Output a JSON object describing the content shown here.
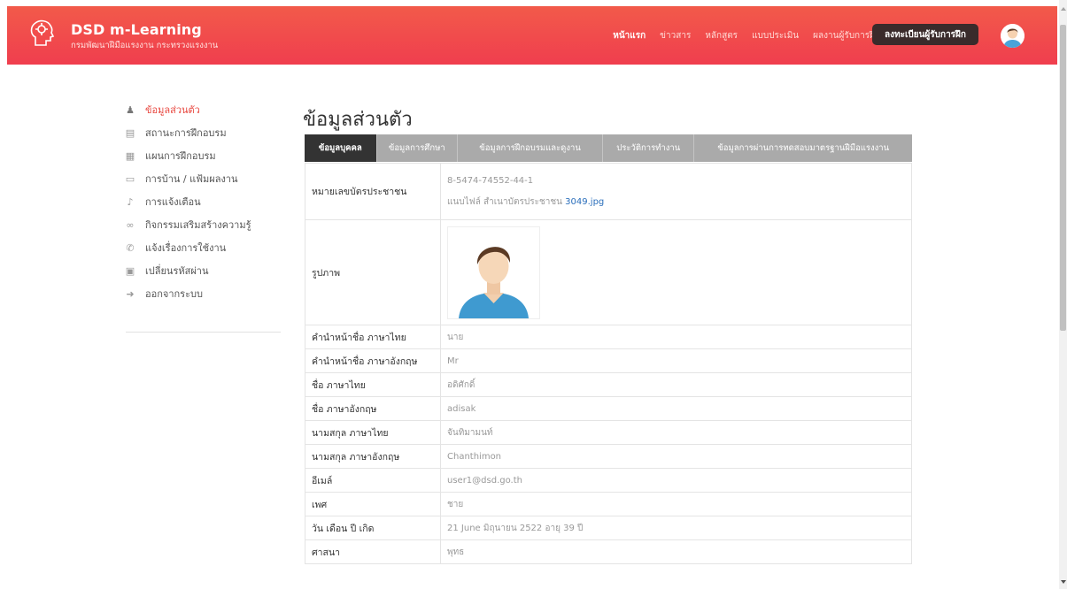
{
  "header": {
    "title": "DSD m-Learning",
    "subtitle": "กรมพัฒนาฝีมือแรงงาน กระทรวงแรงงาน",
    "nav": [
      "หน้าแรก",
      "ข่าวสาร",
      "หลักสูตร",
      "แบบประเมิน",
      "ผลงานผู้รับการฝึก"
    ],
    "register_label": "ลงทะเบียนผู้รับการฝึก",
    "accent_color": "#f0454c"
  },
  "sidebar": {
    "items": [
      {
        "label": "ข้อมูลส่วนตัว",
        "icon": "user-icon"
      },
      {
        "label": "สถานะการฝึกอบรม",
        "icon": "list-icon"
      },
      {
        "label": "แผนการฝึกอบรม",
        "icon": "calendar-icon"
      },
      {
        "label": "การบ้าน / แฟ้มผลงาน",
        "icon": "folder-icon"
      },
      {
        "label": "การแจ้งเตือน",
        "icon": "bell-icon"
      },
      {
        "label": "กิจกรรมเสริมสร้างความรู้",
        "icon": "glasses-icon"
      },
      {
        "label": "แจ้งเรื่องการใช้งาน",
        "icon": "phone-icon"
      },
      {
        "label": "เปลี่ยนรหัสผ่าน",
        "icon": "lock-icon"
      },
      {
        "label": "ออกจากระบบ",
        "icon": "logout-icon"
      }
    ]
  },
  "main": {
    "title": "ข้อมูลส่วนตัว",
    "tabs": [
      "ข้อมูลบุคคล",
      "ข้อมูลการศึกษา",
      "ข้อมูลการฝึกอบรมและดูงาน",
      "ประวัติการทำงาน",
      "ข้อมูลการผ่านการทดสอบมาตรฐานฝีมือแรงงาน"
    ],
    "id_card": {
      "label": "หมายเลขบัตรประชาชน",
      "value": "8-5474-74552-44-1",
      "file_prefix": "แนบไฟล์ สำเนาบัตรประชาชน",
      "file_name": "3049.jpg"
    },
    "photo_label": "รูปภาพ",
    "rows": [
      {
        "label": "คำนำหน้าชื่อ ภาษาไทย",
        "value": "นาย"
      },
      {
        "label": "คำนำหน้าชื่อ ภาษาอังกฤษ",
        "value": "Mr"
      },
      {
        "label": "ชื่อ ภาษาไทย",
        "value": "อดิศักดิ์"
      },
      {
        "label": "ชื่อ ภาษาอังกฤษ",
        "value": "adisak"
      },
      {
        "label": "นามสกุล ภาษาไทย",
        "value": "จันทิมามนท์"
      },
      {
        "label": "นามสกุล ภาษาอังกฤษ",
        "value": "Chanthimon"
      },
      {
        "label": "อีเมล์",
        "value": "user1@dsd.go.th"
      },
      {
        "label": "เพศ",
        "value": "ชาย"
      },
      {
        "label": "วัน เดือน ปี เกิด",
        "value": "21 June มิถุนายน 2522 อายุ 39 ปี"
      },
      {
        "label": "ศาสนา",
        "value": "พุทธ"
      }
    ]
  }
}
